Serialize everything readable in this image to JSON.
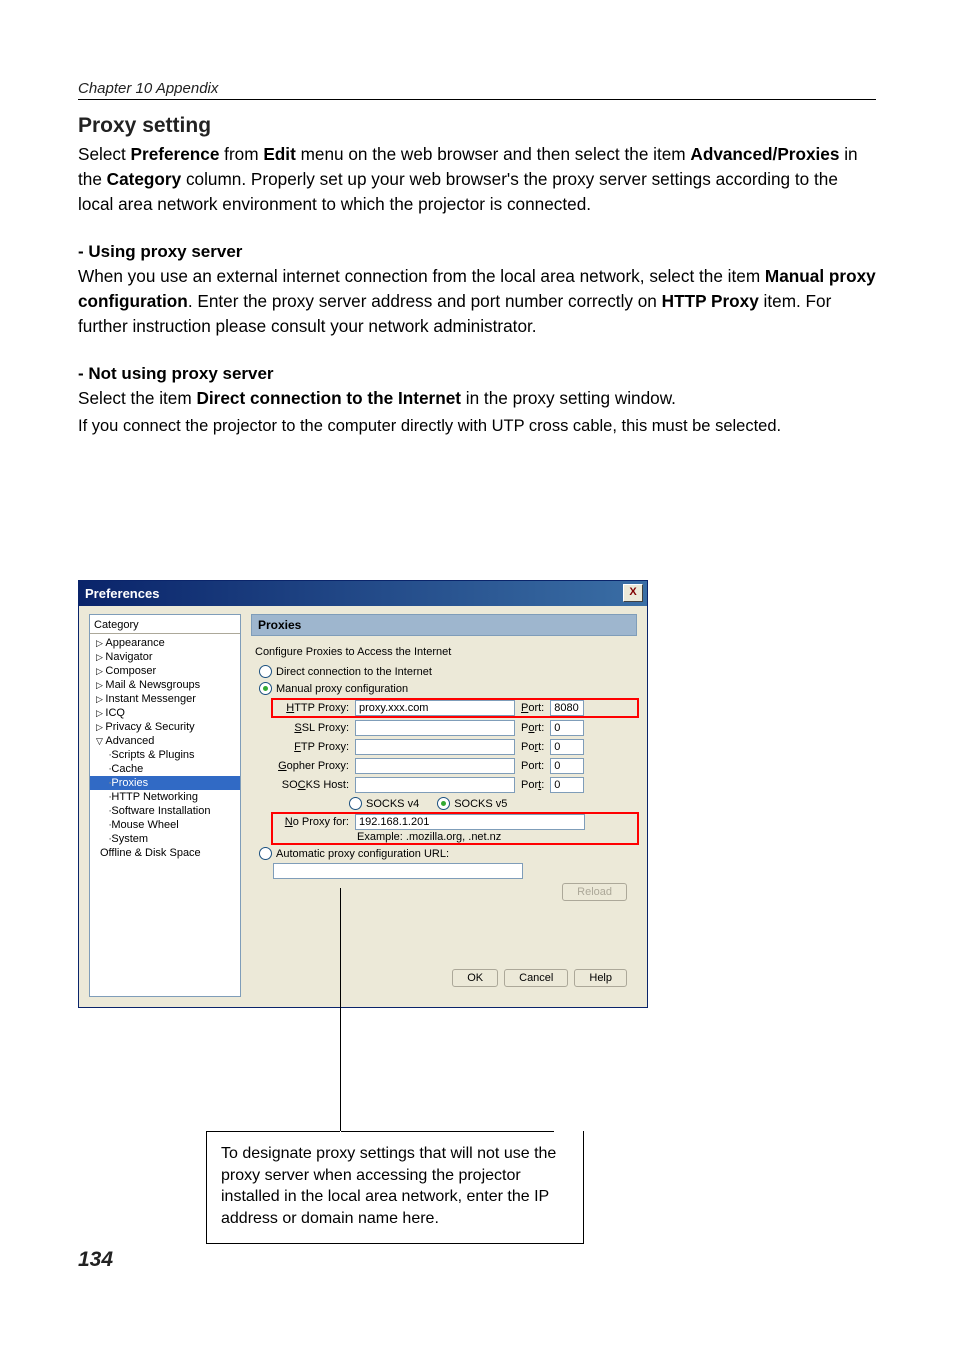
{
  "chapter_header": "Chapter 10 Appendix",
  "section_title": "Proxy setting",
  "para1_a": "Select ",
  "para1_b": "Preference",
  "para1_c": " from ",
  "para1_d": "Edit",
  "para1_e": " menu on the web browser and then select the item ",
  "para1_f": "Advanced/Proxies",
  "para1_g": " in the ",
  "para1_h": "Category",
  "para1_i": " column. Properly set up your web browser's the proxy server settings according to the local area network environment to which the projector is connected.",
  "sub1_title": "- Using proxy server",
  "sub1_a": "When you use an external internet connection from the local area network, select the item ",
  "sub1_b": "Manual proxy configuration",
  "sub1_c": ". Enter the proxy server address and port number correctly on ",
  "sub1_d": "HTTP Proxy",
  "sub1_e": " item. For further instruction please consult your network administrator.",
  "sub2_title": "- Not using proxy server",
  "sub2_a": "Select the item ",
  "sub2_b": "Direct connection to the Internet",
  "sub2_c": " in the proxy setting window.",
  "sub2_note": "If you connect the projector to the computer directly with UTP cross cable, this must be selected.",
  "dialog": {
    "title": "Preferences",
    "close": "X",
    "category_head": "Category",
    "cats": {
      "appearance": "Appearance",
      "navigator": "Navigator",
      "composer": "Composer",
      "mail": "Mail & Newsgroups",
      "im": "Instant Messenger",
      "icq": "ICQ",
      "privacy": "Privacy & Security",
      "advanced": "Advanced",
      "scripts": "Scripts & Plugins",
      "cache": "Cache",
      "proxies": "Proxies",
      "httpnet": "HTTP Networking",
      "softinst": "Software Installation",
      "mouse": "Mouse Wheel",
      "system": "System",
      "offline": "Offline & Disk Space"
    },
    "panel_title": "Proxies",
    "fieldset": "Configure Proxies to Access the Internet",
    "radio_direct": "Direct connection to the Internet",
    "radio_manual": "Manual proxy configuration",
    "labels": {
      "http": "HTTP Proxy:",
      "ssl": "SSL Proxy:",
      "ftp": "FTP Proxy:",
      "gopher": "Gopher Proxy:",
      "socks": "SOCKS Host:",
      "port": "Port:",
      "noproxy": "No Proxy for:",
      "example": "Example: .mozilla.org, .net.nz",
      "socks4": "SOCKS v4",
      "socks5": "SOCKS v5"
    },
    "vals": {
      "http_host": "proxy.xxx.com",
      "http_port": "8080",
      "ssl_port": "0",
      "ftp_port": "0",
      "gopher_port": "0",
      "socks_port": "0",
      "noproxy": "192.168.1.201"
    },
    "radio_auto": "Automatic proxy configuration URL:",
    "reload": "Reload",
    "ok": "OK",
    "cancel": "Cancel",
    "help": "Help"
  },
  "callout": "To designate proxy settings that will not use the proxy server when accessing the projector installed in the local area network, enter the IP address or domain name here.",
  "page_num": "134"
}
